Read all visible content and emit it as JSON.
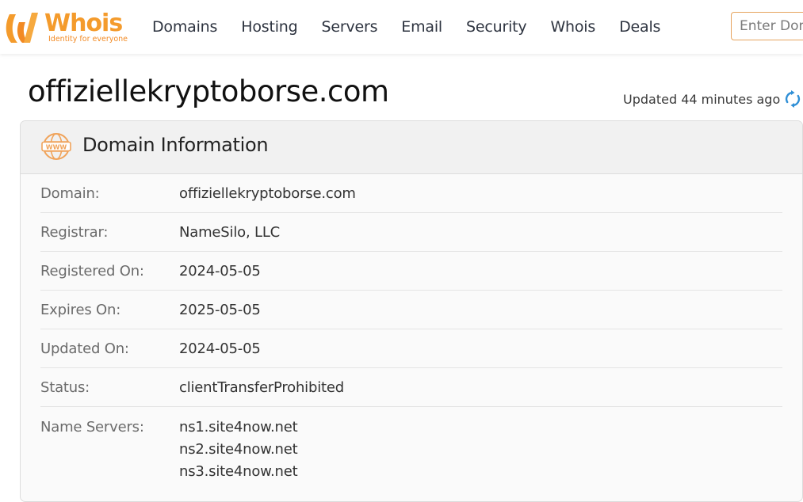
{
  "brand": {
    "name": "Whois",
    "tagline": "Identity for everyone",
    "colors": {
      "primary": "#f49b2c",
      "accent": "#2f8fd6"
    }
  },
  "nav": {
    "items": [
      {
        "label": "Domains"
      },
      {
        "label": "Hosting"
      },
      {
        "label": "Servers"
      },
      {
        "label": "Email"
      },
      {
        "label": "Security"
      },
      {
        "label": "Whois"
      },
      {
        "label": "Deals"
      }
    ]
  },
  "search": {
    "placeholder": "Enter Domain",
    "value": ""
  },
  "page": {
    "domain": "offiziellekryptoborse.com",
    "updated": "Updated 44 minutes ago",
    "refresh_icon": "refresh-icon"
  },
  "card": {
    "title": "Domain Information",
    "icon": "www-icon",
    "rows": [
      {
        "label": "Domain:",
        "value": "offiziellekryptoborse.com"
      },
      {
        "label": "Registrar:",
        "value": "NameSilo, LLC"
      },
      {
        "label": "Registered On:",
        "value": "2024-05-05"
      },
      {
        "label": "Expires On:",
        "value": "2025-05-05"
      },
      {
        "label": "Updated On:",
        "value": "2024-05-05"
      },
      {
        "label": "Status:",
        "value": "clientTransferProhibited"
      }
    ],
    "name_servers": {
      "label": "Name Servers:",
      "values": [
        "ns1.site4now.net",
        "ns2.site4now.net",
        "ns3.site4now.net"
      ]
    }
  }
}
